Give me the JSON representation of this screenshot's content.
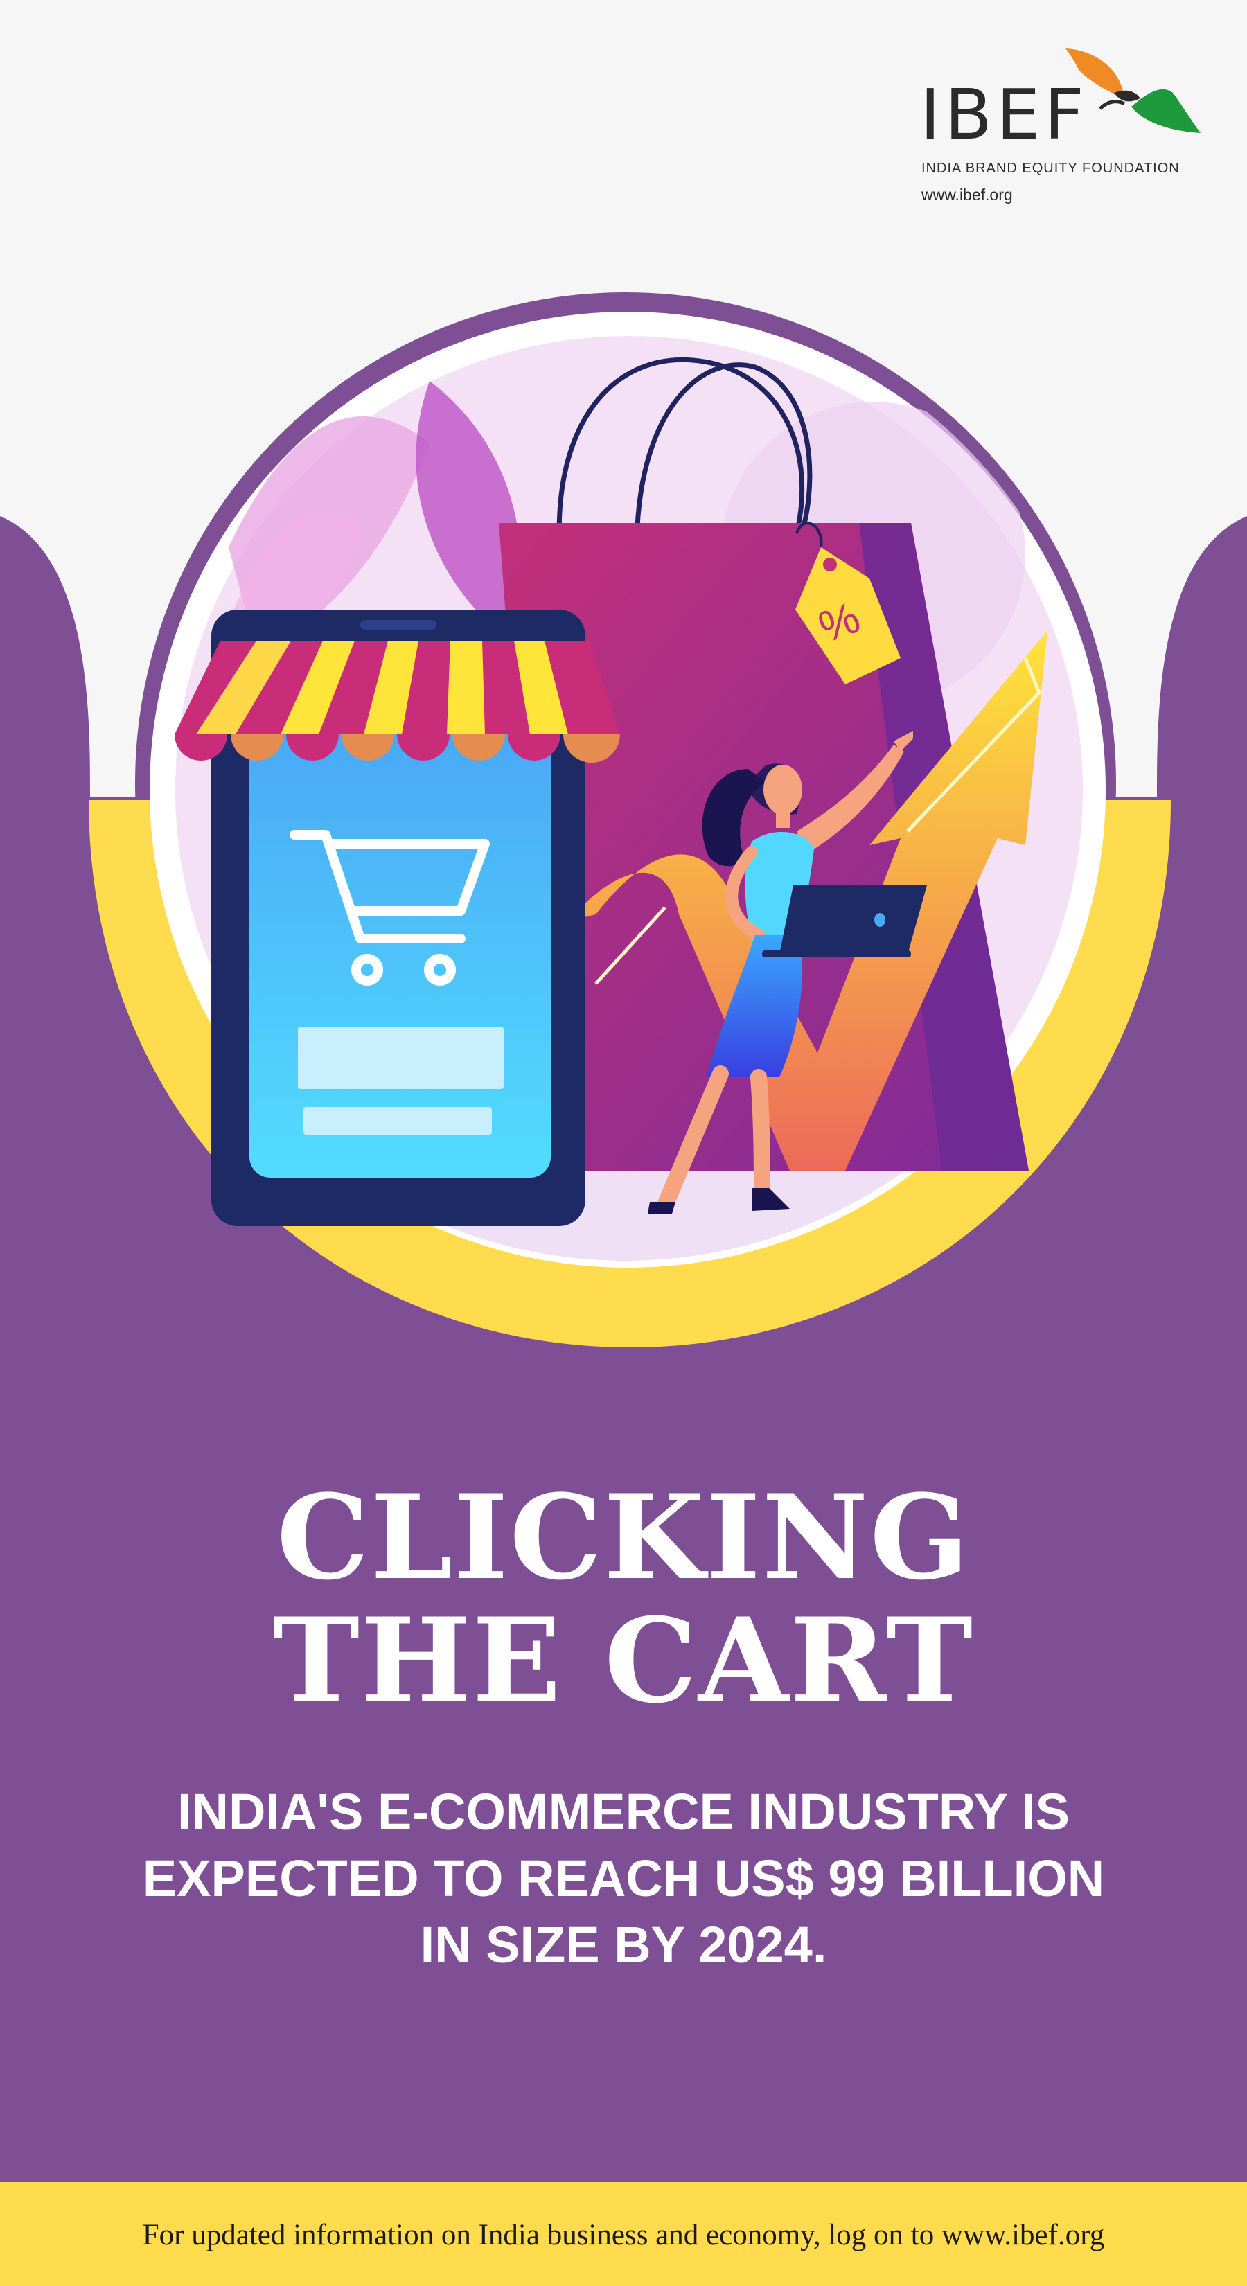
{
  "brand": {
    "logo_word": "IBEF",
    "logo_subtitle": "INDIA BRAND EQUITY FOUNDATION",
    "logo_url": "www.ibef.org"
  },
  "illustration": {
    "tag_symbol": "%",
    "icons": [
      "shopping-cart-icon",
      "shopping-bag-icon",
      "discount-tag-icon",
      "growth-arrow-icon",
      "laptop-icon"
    ]
  },
  "headline": {
    "line1": "CLICKING",
    "line2": "THE CART"
  },
  "body": {
    "line1": "INDIA'S E-COMMERCE INDUSTRY IS",
    "line2": "EXPECTED TO REACH US$ 99 BILLION",
    "line3": "IN SIZE BY 2024."
  },
  "footer": {
    "text": "For updated information on India business and economy, log on to www.ibef.org"
  },
  "colors": {
    "purple": "#7f4f96",
    "yellow": "#ffdb4d",
    "background": "#f6f6f6"
  }
}
